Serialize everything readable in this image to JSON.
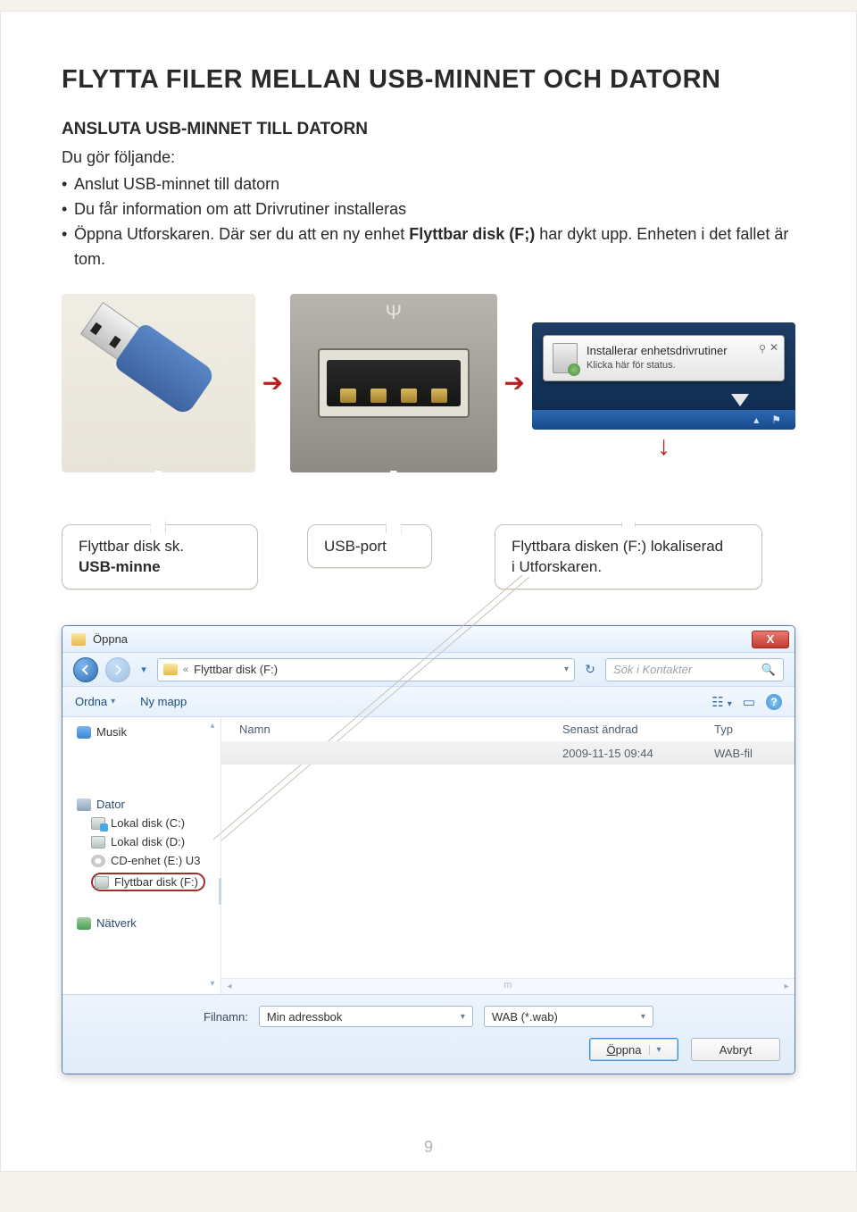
{
  "page_number": "9",
  "heading": "FLYTTA FILER MELLAN USB-MINNET OCH DATORN",
  "subheading": "ANSLUTA USB-MINNET TILL DATORN",
  "intro": "Du gör följande:",
  "bullets": [
    "Anslut USB-minnet till datorn",
    "Du får information om att Drivrutiner installeras",
    {
      "pre": "Öppna Utforskaren. Där ser du att en ny enhet ",
      "bold": "Flyttbar disk (F;)",
      "post": " har dykt upp. Enheten i det fallet är tom."
    }
  ],
  "notification": {
    "title": "Installerar enhetsdrivrutiner",
    "subtitle": "Klicka här för status."
  },
  "callouts": {
    "usb_stick_line1": "Flyttbar disk sk.",
    "usb_stick_line2": "USB-minne",
    "usb_port": "USB-port",
    "explorer_line1": "Flyttbara disken (F:) lokaliserad",
    "explorer_line2": "i Utforskaren."
  },
  "dialog": {
    "title": "Öppna",
    "breadcrumb": "Flyttbar disk (F:)",
    "search_placeholder": "Sök i Kontakter",
    "toolbar": {
      "organize": "Ordna",
      "new_folder": "Ny mapp"
    },
    "columns": {
      "name": "Namn",
      "modified": "Senast ändrad",
      "type": "Typ"
    },
    "row": {
      "name": "",
      "modified": "2009-11-15 09:44",
      "type": "WAB-fil"
    },
    "sidebar": {
      "music": "Musik",
      "computer": "Dator",
      "drive_c": "Lokal disk (C:)",
      "drive_d": "Lokal disk (D:)",
      "cd_e": "CD-enhet (E:) U3",
      "removable_f": "Flyttbar disk (F:)",
      "network": "Nätverk"
    },
    "filename_label": "Filnamn:",
    "filename_value": "Min adressbok",
    "filetype_value": "WAB (*.wab)",
    "open_button": "Öppna",
    "cancel_button": "Avbryt",
    "hscroll_label": "m"
  }
}
